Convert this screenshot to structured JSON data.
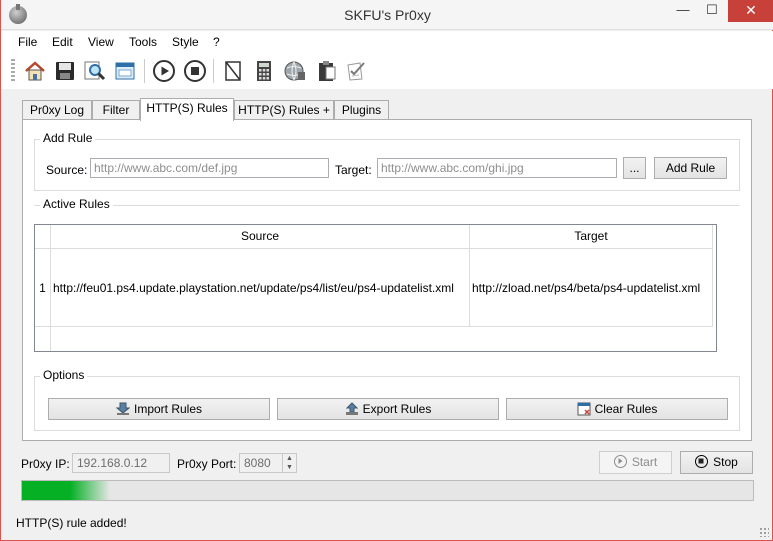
{
  "window": {
    "title": "SKFU's Pr0xy",
    "min": "—",
    "max": "☐",
    "close": "✕"
  },
  "menu": [
    "File",
    "Edit",
    "View",
    "Tools",
    "Style",
    "?"
  ],
  "toolbar_icons": [
    "home-icon",
    "save-icon",
    "search-icon",
    "window-icon",
    "play-icon",
    "stop-icon",
    "document-icon",
    "calculator-icon",
    "globe-icon",
    "clipboard-icon",
    "checklist-icon"
  ],
  "tabs": [
    "Pr0xy Log",
    "Filter",
    "HTTP(S) Rules",
    "HTTP(S) Rules +",
    "Plugins"
  ],
  "active_tab": "HTTP(S) Rules",
  "add_rule": {
    "title": "Add Rule",
    "source_label": "Source:",
    "source_placeholder": "http://www.abc.com/def.jpg",
    "target_label": "Target:",
    "target_placeholder": "http://www.abc.com/ghi.jpg",
    "browse_label": "...",
    "add_button": "Add Rule"
  },
  "active_rules": {
    "title": "Active Rules",
    "columns": [
      "Source",
      "Target"
    ],
    "rows": [
      {
        "index": "1",
        "source": "http://feu01.ps4.update.playstation.net/update/ps4/list/eu/ps4-updatelist.xml",
        "target": "http://zload.net/ps4/beta/ps4-updatelist.xml"
      }
    ]
  },
  "options": {
    "title": "Options",
    "import": "Import Rules",
    "export": "Export Rules",
    "clear": "Clear Rules"
  },
  "proxy": {
    "ip_label": "Pr0xy IP:",
    "ip_value": "192.168.0.12",
    "port_label": "Pr0xy Port:",
    "port_value": "8080"
  },
  "controls": {
    "start": "Start",
    "stop": "Stop"
  },
  "progress": {
    "fraction": 0.12,
    "color": "#06b025"
  },
  "status_text": "HTTP(S) rule added!"
}
